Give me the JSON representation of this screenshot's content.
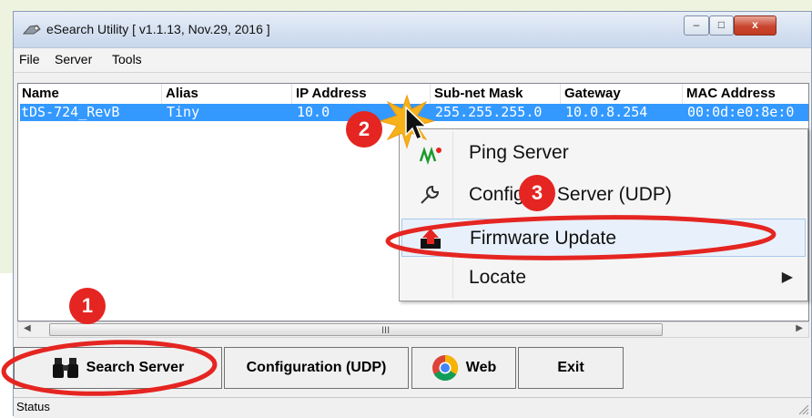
{
  "window": {
    "title": "eSearch Utility [ v1.1.13, Nov.29, 2016 ]",
    "controls": {
      "minimize": "–",
      "maximize": "□",
      "close": "x"
    }
  },
  "menu": [
    "File",
    "Server",
    "Tools"
  ],
  "table": {
    "columns": [
      "Name",
      "Alias",
      "IP Address",
      "Sub-net Mask",
      "Gateway",
      "MAC Address"
    ],
    "selected_row": [
      "tDS-724_RevB",
      "Tiny",
      "10.0",
      "255.255.255.0",
      "10.0.8.254",
      "00:0d:e0:8e:0"
    ]
  },
  "context_menu": {
    "items": [
      {
        "label": "Ping Server",
        "icon": "ping-icon"
      },
      {
        "label": "Configure Server (UDP)",
        "icon": "wrench-icon"
      },
      {
        "label": "Firmware Update",
        "icon": "firmware-update-icon"
      },
      {
        "label": "Locate",
        "icon": "",
        "submenu": "▶"
      }
    ]
  },
  "scrollbar": {
    "left": "◀",
    "right": "▶",
    "grip": "III"
  },
  "buttons": {
    "search": "Search Server",
    "config": "Configuration (UDP)",
    "web": "Web",
    "exit": "Exit"
  },
  "status": "Status",
  "annotations": {
    "step1": "1",
    "step2": "2",
    "step3": "3"
  },
  "colors": {
    "selection": "#3399ff",
    "annotation": "#e52521",
    "highlight": "#e8f1fb"
  }
}
